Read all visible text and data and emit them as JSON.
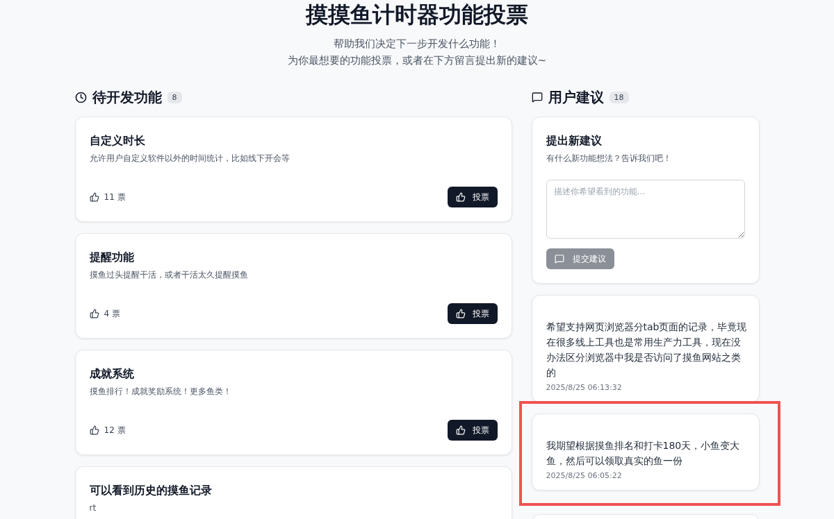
{
  "header": {
    "title": "摸摸鱼计时器功能投票",
    "subtitle_lines": [
      "帮助我们决定下一步开发什么功能！",
      "为你最想要的功能投票，或者在下方留言提出新的建议~"
    ]
  },
  "features_section": {
    "title": "待开发功能",
    "count": "8",
    "items": [
      {
        "title": "自定义时长",
        "description": "允许用户自定义软件以外的时间统计，比如线下开会等",
        "votes": "11 票",
        "vote_button": "投票"
      },
      {
        "title": "提醒功能",
        "description": "摸鱼过头提醒干活，或者干活太久提醒摸鱼",
        "votes": "4 票",
        "vote_button": "投票"
      },
      {
        "title": "成就系统",
        "description": "摸鱼排行！成就奖励系统！更多鱼类！",
        "votes": "12 票",
        "vote_button": "投票"
      },
      {
        "title": "可以看到历史的摸鱼记录",
        "description": "rt"
      }
    ]
  },
  "suggestions_section": {
    "title": "用户建议",
    "count": "18",
    "form": {
      "title": "提出新建议",
      "description": "有什么新功能想法？告诉我们吧！",
      "placeholder": "描述你希望看到的功能...",
      "submit_button": "提交建议",
      "submit_disabled": true
    },
    "items": [
      {
        "text": "希望支持网页浏览器分tab页面的记录，毕竟现在很多线上工具也是常用生产力工具，现在没办法区分浏览器中我是否访问了摸鱼网站之类的",
        "time": "2025/8/25 06:13:32",
        "highlighted": false
      },
      {
        "text": "我期望根据摸鱼排名和打卡180天，小鱼变大鱼，然后可以领取真实的鱼一份",
        "time": "2025/8/25 06:05:22",
        "highlighted": true
      },
      {
        "highlighted": false
      }
    ]
  }
}
